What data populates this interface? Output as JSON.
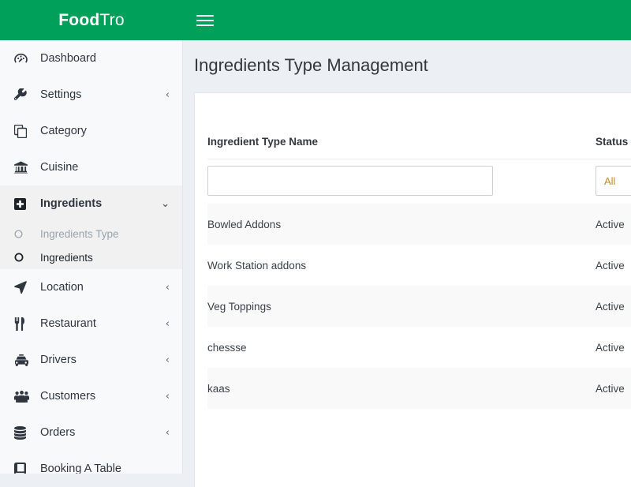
{
  "topbar": {
    "brand_bold": "Food",
    "brand_light": "Tro",
    "menu_icon": "hamburger-icon"
  },
  "sidebar": {
    "items": [
      {
        "label": "Dashboard",
        "icon": "dashboard-icon",
        "chevron": ""
      },
      {
        "label": "Settings",
        "icon": "wrench-icon",
        "chevron": "‹"
      },
      {
        "label": "Category",
        "icon": "copy-icon",
        "chevron": ""
      },
      {
        "label": "Cuisine",
        "icon": "bank-icon",
        "chevron": ""
      },
      {
        "label": "Ingredients",
        "icon": "plus-square-icon",
        "chevron": "⌄"
      },
      {
        "label": "Location",
        "icon": "location-arrow-icon",
        "chevron": "‹"
      },
      {
        "label": "Restaurant",
        "icon": "cutlery-icon",
        "chevron": "‹"
      },
      {
        "label": "Drivers",
        "icon": "taxi-icon",
        "chevron": "‹"
      },
      {
        "label": "Customers",
        "icon": "users-icon",
        "chevron": "‹"
      },
      {
        "label": "Orders",
        "icon": "database-icon",
        "chevron": "‹"
      },
      {
        "label": "Booking A Table",
        "icon": "book-icon",
        "chevron": ""
      }
    ],
    "subitems": [
      {
        "label": "Ingredients Type",
        "icon": "circle-o-icon",
        "state": "muted"
      },
      {
        "label": "Ingredients",
        "icon": "circle-o-icon",
        "state": "active"
      }
    ]
  },
  "main": {
    "page_title": "Ingredients Type Management",
    "table": {
      "headers": [
        "Ingredient Type Name",
        "Status"
      ],
      "filters": {
        "name_value": "",
        "name_placeholder": "",
        "status_value": "All"
      },
      "rows": [
        {
          "name": "Bowled Addons",
          "status": "Active"
        },
        {
          "name": "Work Station addons",
          "status": "Active"
        },
        {
          "name": "Veg Toppings",
          "status": "Active"
        },
        {
          "name": "chessse",
          "status": "Active"
        },
        {
          "name": "kaas",
          "status": "Active"
        }
      ]
    }
  },
  "colors": {
    "brand_green": "#00a05a",
    "page_bg": "#eceff3",
    "sidebar_bg": "#f8f9fa",
    "row_stripe": "#f9f9f9"
  }
}
